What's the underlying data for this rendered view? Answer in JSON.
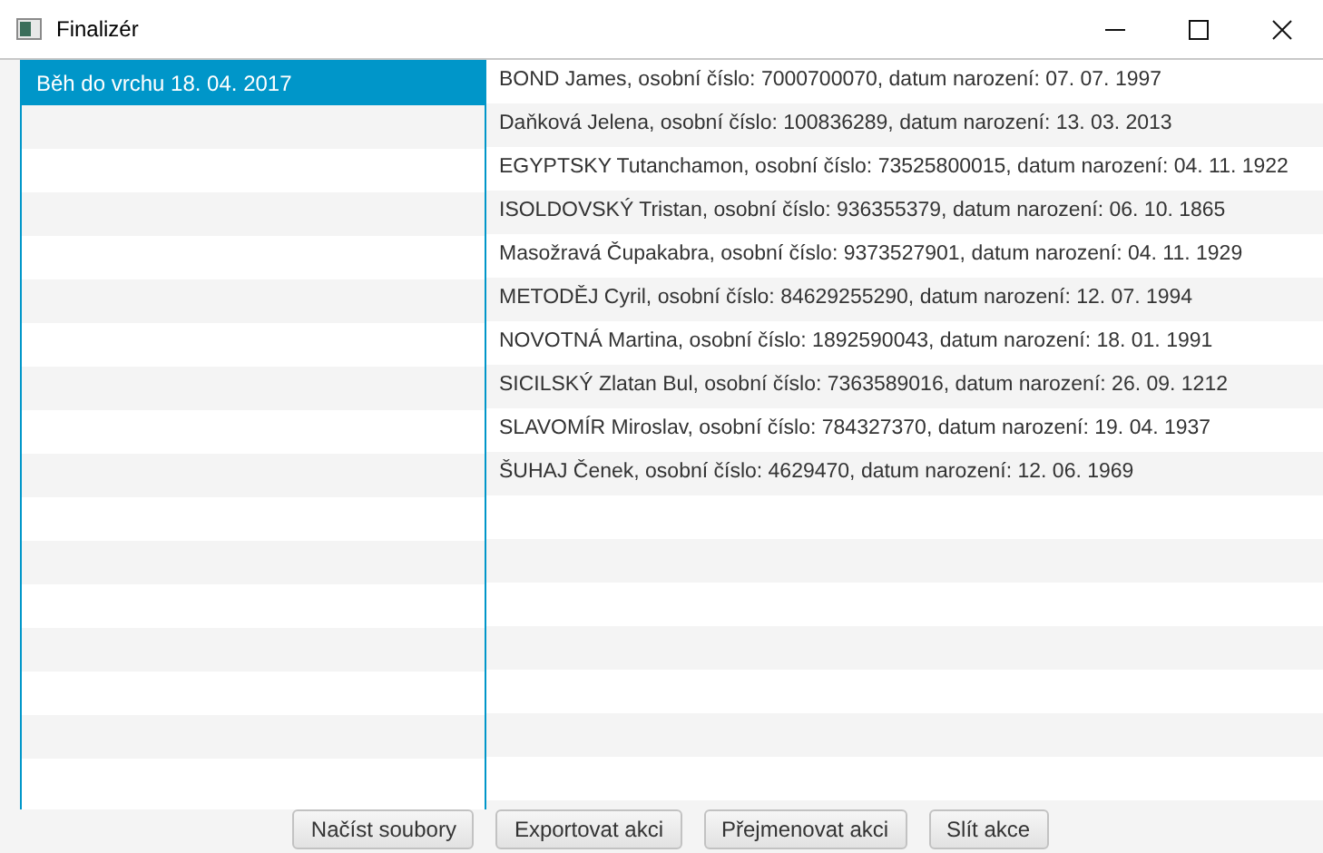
{
  "window": {
    "title": "Finalizér"
  },
  "events": [
    {
      "label": "Běh do vrchu 18. 04. 2017",
      "selected": true
    }
  ],
  "participants": [
    "BOND James, osobní číslo: 7000700070, datum narození: 07. 07. 1997",
    "Daňková Jelena, osobní číslo: 100836289, datum narození: 13. 03. 2013",
    "EGYPTSKY Tutanchamon, osobní číslo: 73525800015, datum narození: 04. 11. 1922",
    "ISOLDOVSKÝ Tristan, osobní číslo: 936355379, datum narození: 06. 10. 1865",
    "Masožravá Čupakabra, osobní číslo: 9373527901, datum narození: 04. 11. 1929",
    "METODĚJ Cyril, osobní číslo: 84629255290, datum narození: 12. 07. 1994",
    "NOVOTNÁ Martina, osobní číslo: 1892590043, datum narození: 18. 01. 1991",
    "SICILSKÝ Zlatan Bul, osobní číslo: 7363589016, datum narození: 26. 09. 1212",
    "SLAVOMÍR Miroslav, osobní číslo: 784327370, datum narození: 19. 04. 1937",
    "ŠUHAJ Čenek, osobní číslo: 4629470, datum narození: 12. 06. 1969"
  ],
  "buttons": [
    "Načíst soubory",
    "Exportovat akci",
    "Přejmenovat akci",
    "Slít akce"
  ]
}
